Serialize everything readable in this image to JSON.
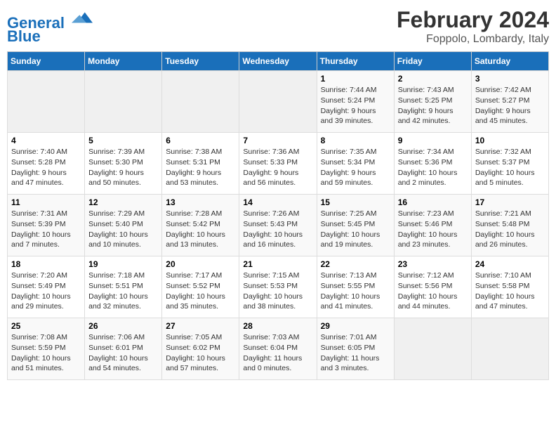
{
  "header": {
    "logo_line1": "General",
    "logo_line2": "Blue",
    "title": "February 2024",
    "subtitle": "Foppolo, Lombardy, Italy"
  },
  "weekdays": [
    "Sunday",
    "Monday",
    "Tuesday",
    "Wednesday",
    "Thursday",
    "Friday",
    "Saturday"
  ],
  "weeks": [
    [
      {
        "day": "",
        "info": ""
      },
      {
        "day": "",
        "info": ""
      },
      {
        "day": "",
        "info": ""
      },
      {
        "day": "",
        "info": ""
      },
      {
        "day": "1",
        "info": "Sunrise: 7:44 AM\nSunset: 5:24 PM\nDaylight: 9 hours\nand 39 minutes."
      },
      {
        "day": "2",
        "info": "Sunrise: 7:43 AM\nSunset: 5:25 PM\nDaylight: 9 hours\nand 42 minutes."
      },
      {
        "day": "3",
        "info": "Sunrise: 7:42 AM\nSunset: 5:27 PM\nDaylight: 9 hours\nand 45 minutes."
      }
    ],
    [
      {
        "day": "4",
        "info": "Sunrise: 7:40 AM\nSunset: 5:28 PM\nDaylight: 9 hours\nand 47 minutes."
      },
      {
        "day": "5",
        "info": "Sunrise: 7:39 AM\nSunset: 5:30 PM\nDaylight: 9 hours\nand 50 minutes."
      },
      {
        "day": "6",
        "info": "Sunrise: 7:38 AM\nSunset: 5:31 PM\nDaylight: 9 hours\nand 53 minutes."
      },
      {
        "day": "7",
        "info": "Sunrise: 7:36 AM\nSunset: 5:33 PM\nDaylight: 9 hours\nand 56 minutes."
      },
      {
        "day": "8",
        "info": "Sunrise: 7:35 AM\nSunset: 5:34 PM\nDaylight: 9 hours\nand 59 minutes."
      },
      {
        "day": "9",
        "info": "Sunrise: 7:34 AM\nSunset: 5:36 PM\nDaylight: 10 hours\nand 2 minutes."
      },
      {
        "day": "10",
        "info": "Sunrise: 7:32 AM\nSunset: 5:37 PM\nDaylight: 10 hours\nand 5 minutes."
      }
    ],
    [
      {
        "day": "11",
        "info": "Sunrise: 7:31 AM\nSunset: 5:39 PM\nDaylight: 10 hours\nand 7 minutes."
      },
      {
        "day": "12",
        "info": "Sunrise: 7:29 AM\nSunset: 5:40 PM\nDaylight: 10 hours\nand 10 minutes."
      },
      {
        "day": "13",
        "info": "Sunrise: 7:28 AM\nSunset: 5:42 PM\nDaylight: 10 hours\nand 13 minutes."
      },
      {
        "day": "14",
        "info": "Sunrise: 7:26 AM\nSunset: 5:43 PM\nDaylight: 10 hours\nand 16 minutes."
      },
      {
        "day": "15",
        "info": "Sunrise: 7:25 AM\nSunset: 5:45 PM\nDaylight: 10 hours\nand 19 minutes."
      },
      {
        "day": "16",
        "info": "Sunrise: 7:23 AM\nSunset: 5:46 PM\nDaylight: 10 hours\nand 23 minutes."
      },
      {
        "day": "17",
        "info": "Sunrise: 7:21 AM\nSunset: 5:48 PM\nDaylight: 10 hours\nand 26 minutes."
      }
    ],
    [
      {
        "day": "18",
        "info": "Sunrise: 7:20 AM\nSunset: 5:49 PM\nDaylight: 10 hours\nand 29 minutes."
      },
      {
        "day": "19",
        "info": "Sunrise: 7:18 AM\nSunset: 5:51 PM\nDaylight: 10 hours\nand 32 minutes."
      },
      {
        "day": "20",
        "info": "Sunrise: 7:17 AM\nSunset: 5:52 PM\nDaylight: 10 hours\nand 35 minutes."
      },
      {
        "day": "21",
        "info": "Sunrise: 7:15 AM\nSunset: 5:53 PM\nDaylight: 10 hours\nand 38 minutes."
      },
      {
        "day": "22",
        "info": "Sunrise: 7:13 AM\nSunset: 5:55 PM\nDaylight: 10 hours\nand 41 minutes."
      },
      {
        "day": "23",
        "info": "Sunrise: 7:12 AM\nSunset: 5:56 PM\nDaylight: 10 hours\nand 44 minutes."
      },
      {
        "day": "24",
        "info": "Sunrise: 7:10 AM\nSunset: 5:58 PM\nDaylight: 10 hours\nand 47 minutes."
      }
    ],
    [
      {
        "day": "25",
        "info": "Sunrise: 7:08 AM\nSunset: 5:59 PM\nDaylight: 10 hours\nand 51 minutes."
      },
      {
        "day": "26",
        "info": "Sunrise: 7:06 AM\nSunset: 6:01 PM\nDaylight: 10 hours\nand 54 minutes."
      },
      {
        "day": "27",
        "info": "Sunrise: 7:05 AM\nSunset: 6:02 PM\nDaylight: 10 hours\nand 57 minutes."
      },
      {
        "day": "28",
        "info": "Sunrise: 7:03 AM\nSunset: 6:04 PM\nDaylight: 11 hours\nand 0 minutes."
      },
      {
        "day": "29",
        "info": "Sunrise: 7:01 AM\nSunset: 6:05 PM\nDaylight: 11 hours\nand 3 minutes."
      },
      {
        "day": "",
        "info": ""
      },
      {
        "day": "",
        "info": ""
      }
    ]
  ]
}
